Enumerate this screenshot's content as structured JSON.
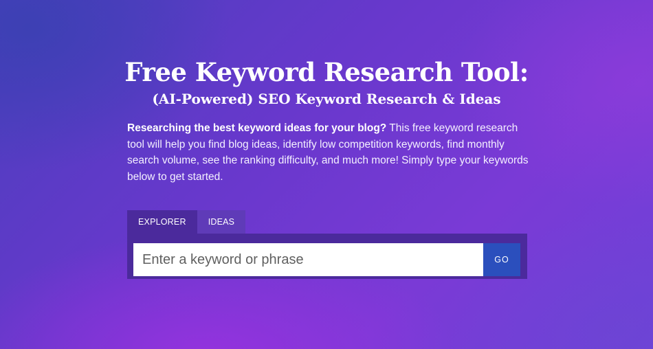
{
  "hero": {
    "title": "Free Keyword Research Tool:",
    "subtitle": "(AI-Powered) SEO Keyword Research & Ideas",
    "intro_bold": "Researching the best keyword ideas for your blog?",
    "intro_text": " This free keyword research tool will help you find blog ideas, identify low competition keywords, find monthly search volume, see the ranking difficulty, and much more! Simply type your keywords below to get started."
  },
  "tool": {
    "tabs": [
      {
        "label": "EXPLORER",
        "active": true
      },
      {
        "label": "IDEAS",
        "active": false
      }
    ],
    "search": {
      "value": "",
      "placeholder": "Enter a keyword or phrase"
    },
    "go_label": "GO"
  },
  "colors": {
    "background_start": "#4a3fbd",
    "background_end": "#7a3ad6",
    "panel": "#4b2a9c",
    "inactive_tab": "#5f3bb8",
    "go_button": "#2b4fbd",
    "text": "#ffffff"
  }
}
